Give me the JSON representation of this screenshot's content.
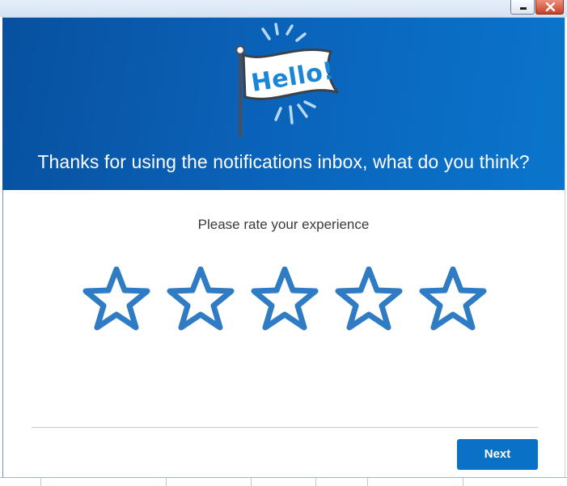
{
  "window": {
    "minimize_icon": "minimize-icon",
    "close_icon": "close-icon"
  },
  "banner": {
    "flag_text": "Hello!",
    "title": "Thanks for using the notifications inbox, what do you think?",
    "colors": {
      "gradient_start": "#08509f",
      "gradient_end": "#0a75cc"
    }
  },
  "rating": {
    "prompt": "Please rate your experience",
    "max_stars": 5,
    "selected": 0,
    "star_color": "#2f7bc4",
    "star_icon": "star-outline-icon"
  },
  "footer": {
    "next_label": "Next",
    "accent": "#0a72c6"
  }
}
